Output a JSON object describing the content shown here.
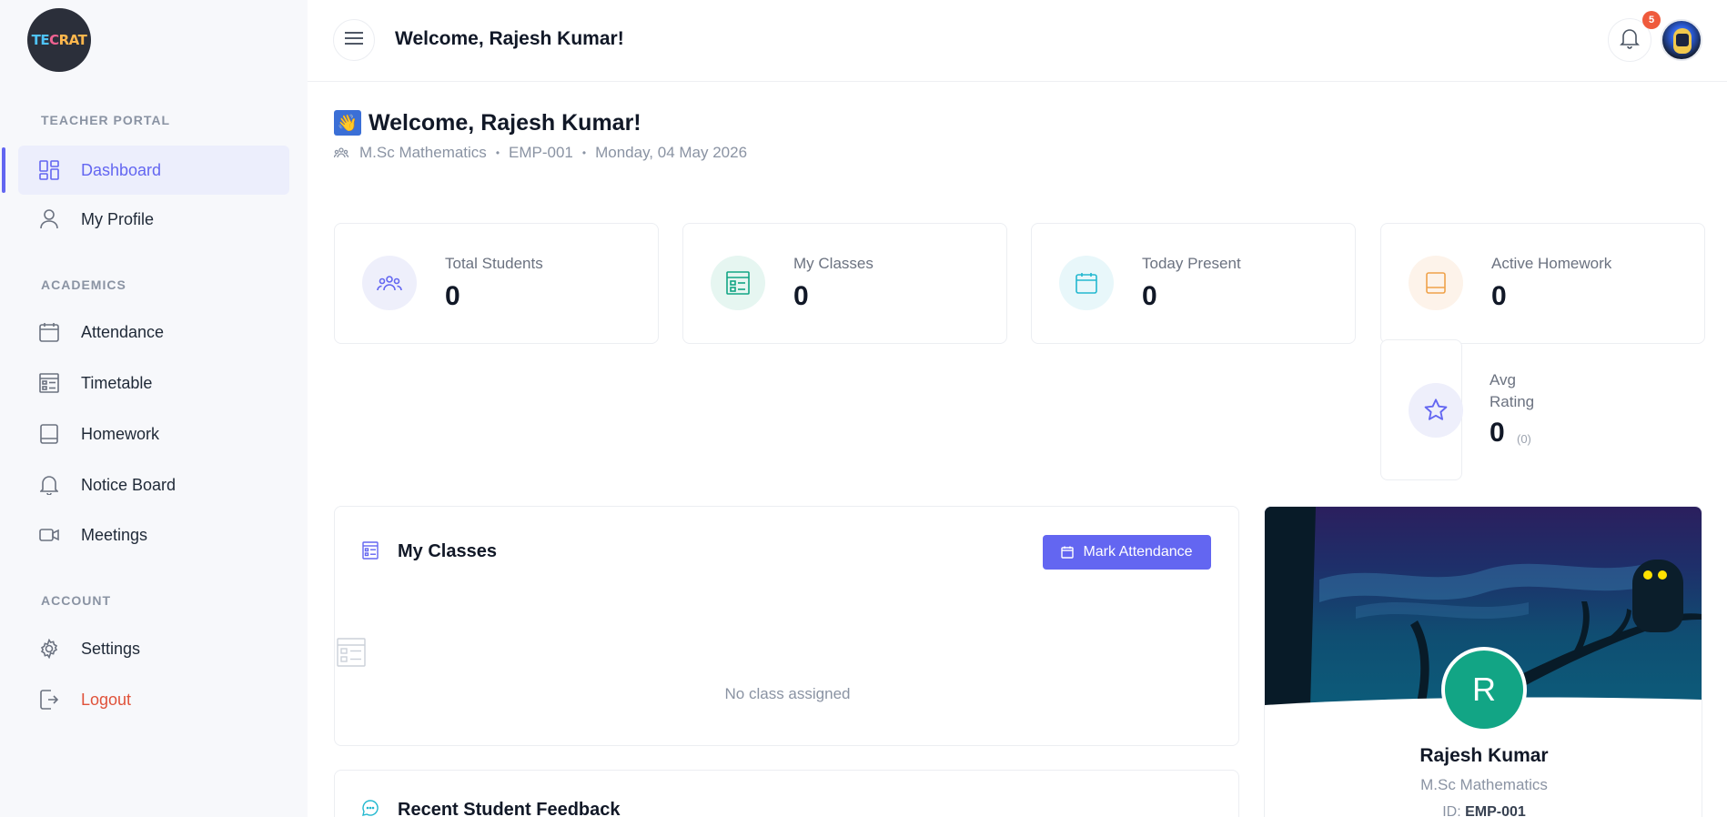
{
  "logo": {
    "part1": "TE",
    "part2": "C",
    "part3": "RAT"
  },
  "sidebar": {
    "sections": [
      {
        "label": "TEACHER PORTAL"
      },
      {
        "label": "ACADEMICS"
      },
      {
        "label": "ACCOUNT"
      }
    ],
    "items": [
      {
        "label": "Dashboard",
        "icon": "dashboard-icon"
      },
      {
        "label": "My Profile",
        "icon": "user-icon"
      },
      {
        "label": "Attendance",
        "icon": "calendar-icon"
      },
      {
        "label": "Timetable",
        "icon": "timetable-icon"
      },
      {
        "label": "Homework",
        "icon": "book-icon"
      },
      {
        "label": "Notice Board",
        "icon": "bell-icon"
      },
      {
        "label": "Meetings",
        "icon": "video-icon"
      },
      {
        "label": "Settings",
        "icon": "gear-icon"
      },
      {
        "label": "Logout",
        "icon": "logout-icon"
      }
    ]
  },
  "header": {
    "title": "Welcome, Rajesh Kumar!",
    "notification_count": "5"
  },
  "page": {
    "emoji": "👋",
    "title": "Welcome, Rajesh Kumar!",
    "qualification": "M.Sc Mathematics",
    "employee_id": "EMP-001",
    "date": "Monday, 04 May 2026"
  },
  "stats": [
    {
      "label": "Total Students",
      "value": "0",
      "icon": "students-icon"
    },
    {
      "label": "My Classes",
      "value": "0",
      "icon": "classes-icon"
    },
    {
      "label": "Today Present",
      "value": "0",
      "icon": "calendar-icon"
    },
    {
      "label": "Active Homework",
      "value": "0",
      "icon": "book-icon"
    }
  ],
  "rating": {
    "label": "Avg Rating",
    "value": "0",
    "count": "(0)"
  },
  "classes_panel": {
    "title": "My Classes",
    "button_label": "Mark Attendance",
    "empty_text": "No class assigned"
  },
  "feedback_panel": {
    "title": "Recent Student Feedback"
  },
  "profile": {
    "initial": "R",
    "name": "Rajesh Kumar",
    "degree": "M.Sc Mathematics",
    "id_label": "ID:",
    "id_value": "EMP-001"
  },
  "colors": {
    "accent": "#6366f1",
    "logout": "#e0523a",
    "badge": "#ef5a3c",
    "profile_avatar": "#12a585"
  }
}
